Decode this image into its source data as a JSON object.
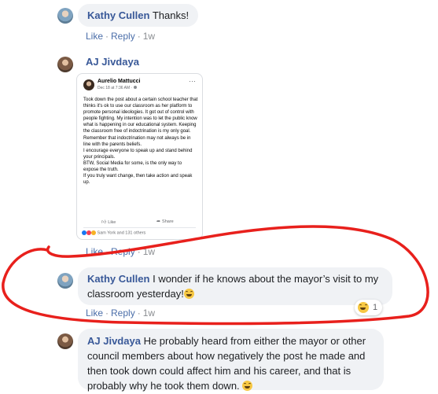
{
  "comments": [
    {
      "author": "Kathy Cullen",
      "text": "Thanks!",
      "actions": {
        "like": "Like",
        "reply": "Reply",
        "time": "1w"
      }
    },
    {
      "author": "AJ Jivdaya",
      "actions": {
        "like": "Like",
        "reply": "Reply",
        "time": "1w"
      },
      "shared_post": {
        "author": "Aurelio Mattucci",
        "date": "Dec 18 at 7:36 AM · ",
        "more": "···",
        "body": "Took down the post about a certain school teacher that thinks it's ok to use our classroom as her platform to promote personal ideologies. It got out of control with people fighting. My intention was to let the public know what is happening in our educational system. Keeping the classroom free of indoctrination is my only goal. Remember that indoctrination may not always be in line with the parents beliefs.\nI encourage everyone to speak up and stand behind your principals.\nBTW, Social Media for some, is the only way to expose the truth.\nIf you truly want change, then take action and speak up.",
        "like_label": "Like",
        "share_label": "Share",
        "reactions_text": "Sam York and 131 others"
      }
    },
    {
      "author": "Kathy Cullen",
      "text": "I wonder if he knows about the mayor’s visit to my classroom yesterday!",
      "actions": {
        "like": "Like",
        "reply": "Reply",
        "time": "1w"
      },
      "reaction_count": "1"
    },
    {
      "author": "AJ Jivdaya",
      "text": "He probably heard from either the mayor or other council members about how negatively the post he made and then took down could affect him and his career, and that is probably why he took them down."
    }
  ],
  "colors": {
    "author": "#385898",
    "bubble": "#f0f2f5",
    "link": "#4b6ea9",
    "annotation": "#e8201c"
  }
}
